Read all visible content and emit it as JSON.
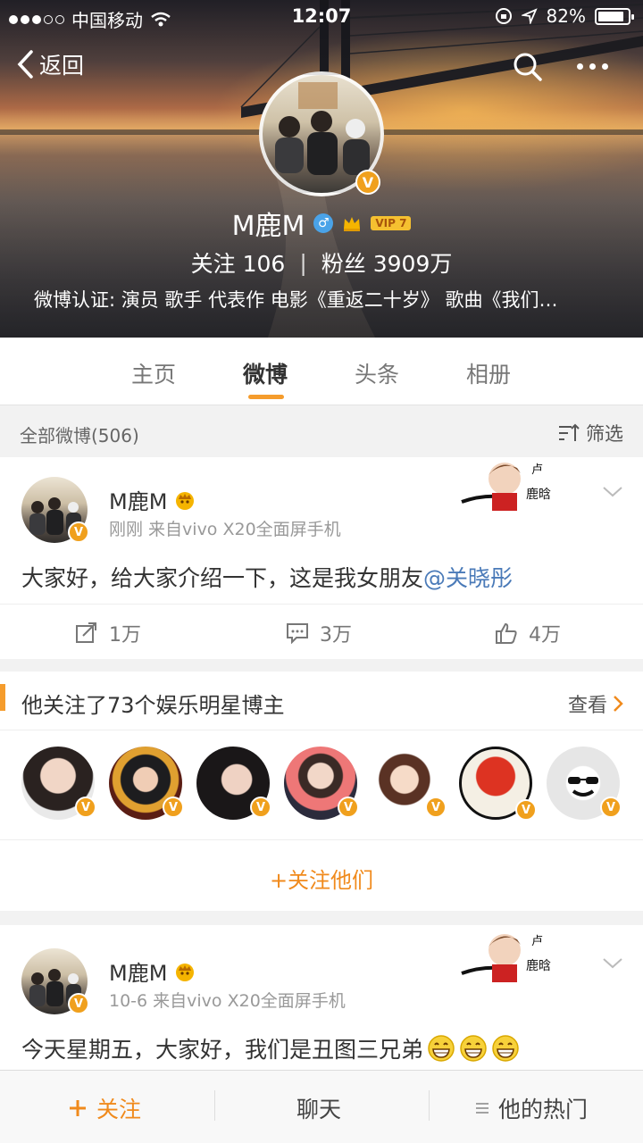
{
  "status_bar": {
    "carrier": "中国移动",
    "time": "12:07",
    "battery": "82%"
  },
  "nav": {
    "back_label": "返回"
  },
  "profile": {
    "name": "M鹿M",
    "vip": "VIP 7",
    "following_label": "关注",
    "following_count": "106",
    "followers_label": "粉丝",
    "followers_count": "3909万",
    "verification": "微博认证: 演员 歌手 代表作 电影《重返二十岁》 歌曲《我们…"
  },
  "tabs": [
    {
      "label": "主页"
    },
    {
      "label": "微博"
    },
    {
      "label": "头条"
    },
    {
      "label": "相册"
    }
  ],
  "filter_bar": {
    "count_label": "全部微博(506)",
    "filter_label": "筛选"
  },
  "posts": [
    {
      "name": "M鹿M",
      "meta": "刚刚  来自vivo X20全面屏手机",
      "text": "大家好，给大家介绍一下，这是我女朋友",
      "mention": "@关晓彤",
      "reposts": "1万",
      "comments": "3万",
      "likes": "4万"
    },
    {
      "name": "M鹿M",
      "meta": "10-6  来自vivo X20全面屏手机",
      "text": "今天星期五，大家好，我们是丑图三兄弟"
    }
  ],
  "recommendation": {
    "title": "他关注了73个娱乐明星博主",
    "more_label": "查看",
    "follow_label": "+关注他们"
  },
  "bottom_bar": {
    "follow": "关注",
    "chat": "聊天",
    "hot": "他的热门"
  },
  "colors": {
    "accent": "#f59c2c",
    "link": "#4a7ab8",
    "verified": "#f0a01d"
  }
}
